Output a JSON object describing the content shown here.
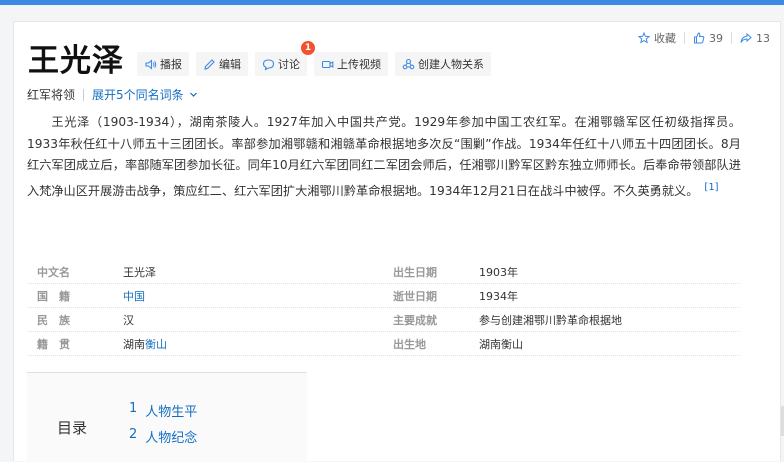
{
  "title": "王光泽",
  "toolbar": {
    "broadcast": "播报",
    "edit": "编辑",
    "discuss": "讨论",
    "discuss_badge": "1",
    "upload_video": "上传视频",
    "create_relation": "创建人物关系"
  },
  "actions": {
    "favorite": "收藏",
    "like_count": "39",
    "share_count": "13"
  },
  "subtitle": {
    "description": "红军将领",
    "expand": "展开5个同名词条"
  },
  "summary": {
    "text": "王光泽（1903-1934），湖南茶陵人。1927年加入中国共产党。1929年参加中国工农红军。在湘鄂赣军区任初级指挥员。1933年秋任红十八师五十三团团长。率部参加湘鄂赣和湘赣革命根据地多次反“围剿”作战。1934年任红十八师五十四团团长。8月红六军团成立后，率部随军团参加长征。同年10月红六军团同红二军团会师后，任湘鄂川黔军区黔东独立师师长。后奉命带领部队进入梵净山区开展游击战争，策应红二、红六军团扩大湘鄂川黔革命根据地。1934年12月21日在战斗中被俘。不久英勇就义。",
    "ref": "[1]"
  },
  "info": {
    "chinese_name_k": "中文名",
    "chinese_name_v": "王光泽",
    "birth_date_k": "出生日期",
    "birth_date_v": "1903年",
    "nationality_k": "国　籍",
    "nationality_v": "中国",
    "death_date_k": "逝世日期",
    "death_date_v": "1934年",
    "ethnicity_k": "民　族",
    "ethnicity_v": "汉",
    "achievement_k": "主要成就",
    "achievement_v": "参与创建湘鄂川黔革命根据地",
    "native_place_k": "籍　贯",
    "native_place_prefix": "湖南",
    "native_place_link": "衡山",
    "birthplace_k": "出生地",
    "birthplace_v": "湖南衡山"
  },
  "toc": {
    "label": "目录",
    "items": [
      {
        "num": "1",
        "text": "人物生平"
      },
      {
        "num": "2",
        "text": "人物纪念"
      }
    ]
  },
  "colors": {
    "accent": "#136ec2",
    "topbar": "#3d8ae4",
    "badge": "#f0512e"
  }
}
